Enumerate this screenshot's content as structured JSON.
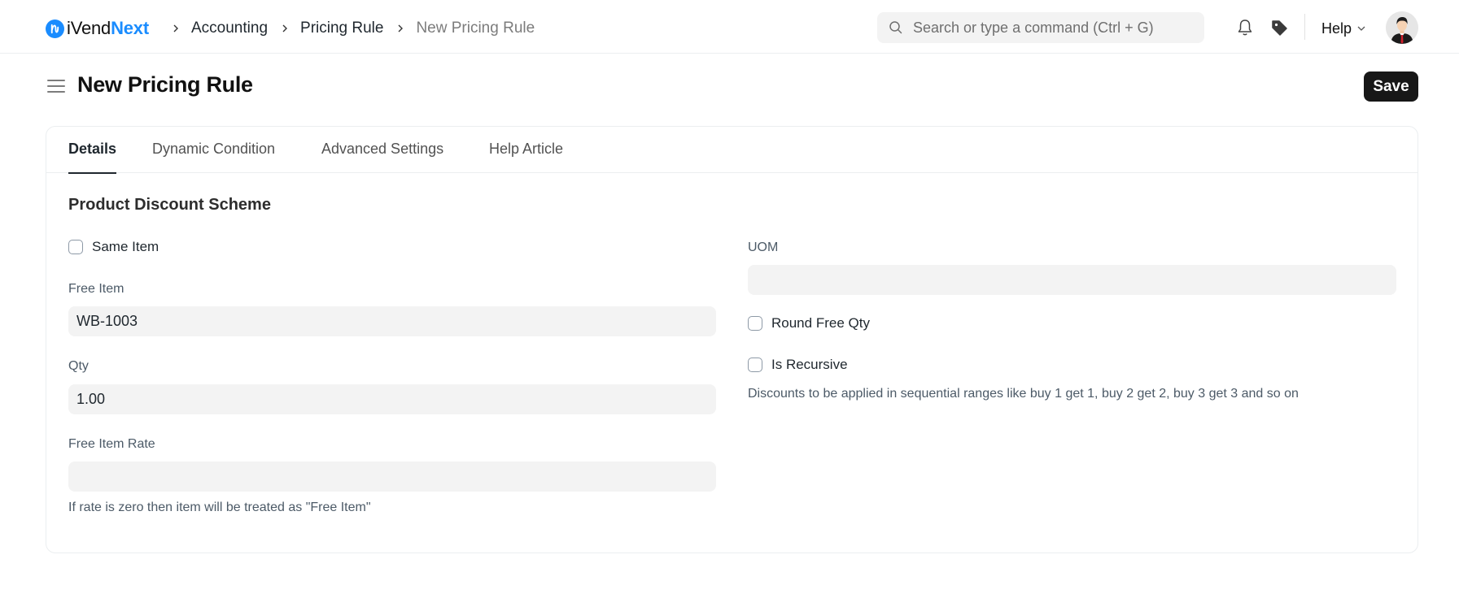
{
  "navbar": {
    "logo_prefix": "iVend",
    "logo_suffix": "Next",
    "brand_color": "#1a8cff",
    "breadcrumbs": [
      {
        "label": "Accounting"
      },
      {
        "label": "Pricing Rule"
      },
      {
        "label": "New Pricing Rule"
      }
    ],
    "search": {
      "placeholder": "Search or type a command (Ctrl + G)",
      "value": ""
    },
    "help_label": "Help",
    "icons": {
      "notifications": "bell-icon",
      "tags": "tag-icon",
      "avatar": "user-avatar"
    }
  },
  "page": {
    "title": "New Pricing Rule",
    "save_label": "Save"
  },
  "tabs": [
    {
      "label": "Details",
      "active": true
    },
    {
      "label": "Dynamic Condition",
      "active": false
    },
    {
      "label": "Advanced Settings",
      "active": false
    },
    {
      "label": "Help Article",
      "active": false
    }
  ],
  "section": {
    "title": "Product Discount Scheme",
    "left": {
      "same_item": {
        "label": "Same Item",
        "checked": false
      },
      "free_item": {
        "label": "Free Item",
        "value": ""
      },
      "free_item_value": "WB-1003",
      "qty": {
        "label": "Qty",
        "value": "1.00"
      },
      "free_item_rate": {
        "label": "Free Item Rate",
        "value": ""
      },
      "free_item_rate_help": "If rate is zero then item will be treated as \"Free Item\""
    },
    "right": {
      "uom": {
        "label": "UOM",
        "value": ""
      },
      "round_free_qty": {
        "label": "Round Free Qty",
        "checked": false
      },
      "is_recursive": {
        "label": "Is Recursive",
        "checked": false
      },
      "is_recursive_help": "Discounts to be applied in sequential ranges like buy 1 get 1, buy 2 get 2, buy 3 get 3 and so on"
    }
  }
}
